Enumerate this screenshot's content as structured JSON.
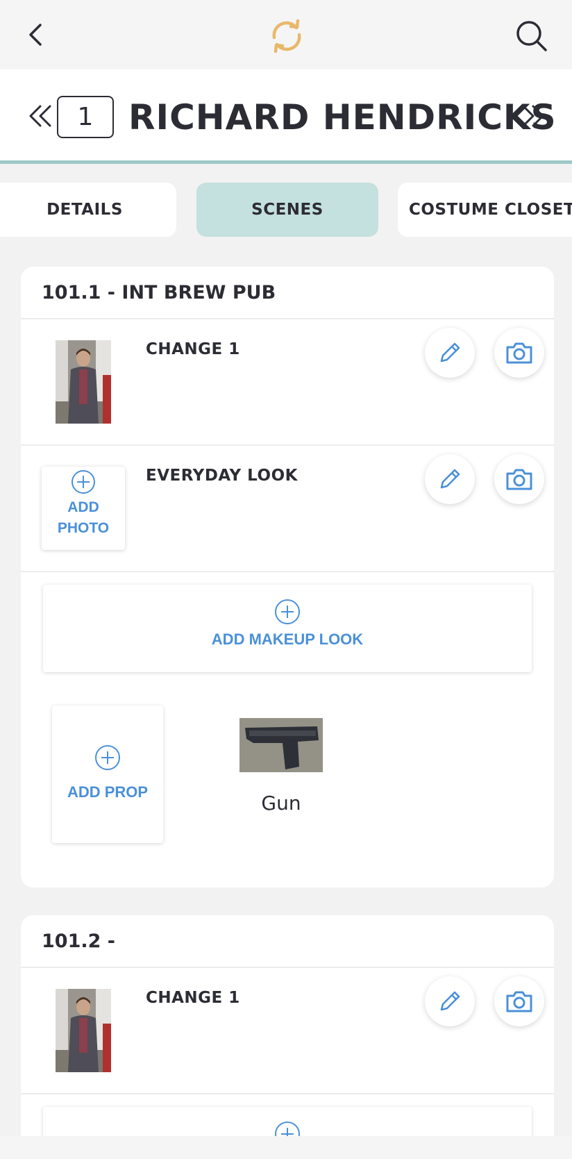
{
  "topbar": {
    "back_icon": "chevron-left-icon",
    "sync_icon": "sync-icon",
    "sync_color": "#e8b86a",
    "search_icon": "search-icon"
  },
  "header": {
    "character_number": "1",
    "character_name": "RICHARD HENDRICKS",
    "prev_icon": "double-chevron-left-icon",
    "next_icon": "double-chevron-right-icon",
    "accent_color": "#9dcac8"
  },
  "tabs": [
    {
      "label": "DETAILS",
      "active": false
    },
    {
      "label": "SCENES",
      "active": true
    },
    {
      "label": "COSTUME CLOSET",
      "active": false
    }
  ],
  "scenes": [
    {
      "title": "101.1 - INT BREW PUB",
      "changes": [
        {
          "label": "CHANGE 1",
          "has_photo": true
        },
        {
          "label": "EVERYDAY LOOK",
          "has_photo": false
        }
      ],
      "add_photo_label_1": "ADD",
      "add_photo_label_2": "PHOTO",
      "add_makeup_label": "ADD MAKEUP LOOK",
      "add_prop_label": "ADD PROP",
      "props": [
        {
          "name": "Gun"
        }
      ]
    },
    {
      "title": "101.2 -",
      "changes": [
        {
          "label": "CHANGE 1",
          "has_photo": true
        }
      ]
    }
  ],
  "colors": {
    "link_blue": "#4a90d9",
    "active_tab": "#c4e0df"
  }
}
